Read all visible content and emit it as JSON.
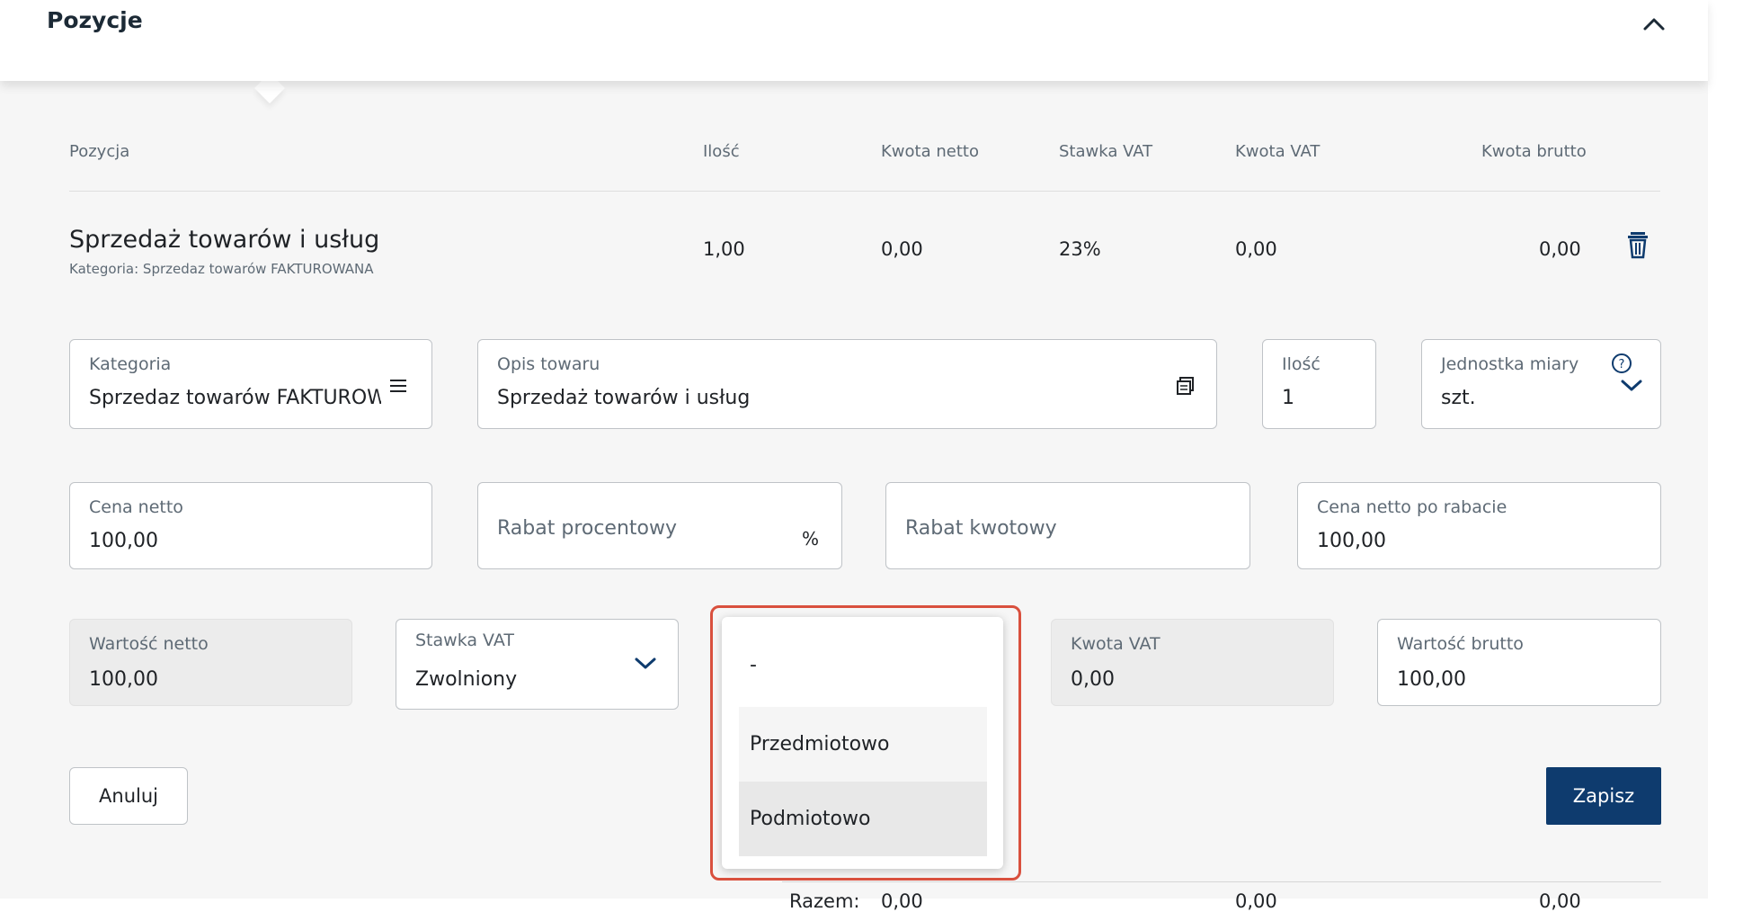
{
  "header": {
    "title": "Pozycje"
  },
  "columns": [
    "Pozycja",
    "Ilość",
    "Kwota netto",
    "Stawka VAT",
    "Kwota VAT",
    "Kwota brutto"
  ],
  "item": {
    "title": "Sprzedaż towarów i usług",
    "subtitle": "Kategoria: Sprzedaz towarów FAKTUROWANA",
    "qty": "1,00",
    "net": "0,00",
    "vat_rate": "23%",
    "vat_amount": "0,00",
    "gross": "0,00"
  },
  "form": {
    "kategoria": {
      "label": "Kategoria",
      "value": "Sprzedaz towarów FAKTUROWANA"
    },
    "opis": {
      "label": "Opis towaru",
      "value": "Sprzedaż towarów i usług"
    },
    "ilosc": {
      "label": "Ilość",
      "value": "1"
    },
    "jednostka": {
      "label": "Jednostka miary",
      "value": "szt."
    },
    "cena_netto": {
      "label": "Cena netto",
      "value": "100,00"
    },
    "rabat_proc": {
      "placeholder": "Rabat procentowy",
      "suffix": "%"
    },
    "rabat_kw": {
      "placeholder": "Rabat kwotowy"
    },
    "cena_po_rabacie": {
      "label": "Cena netto po rabacie",
      "value": "100,00"
    },
    "wartosc_netto": {
      "label": "Wartość netto",
      "value": "100,00"
    },
    "stawka_vat": {
      "label": "Stawka VAT",
      "value": "Zwolniony"
    },
    "kwota_vat": {
      "label": "Kwota VAT",
      "value": "0,00"
    },
    "wartosc_brutto": {
      "label": "Wartość brutto",
      "value": "100,00"
    }
  },
  "dropdown": {
    "options": [
      "-",
      "Przedmiotowo",
      "Podmiotowo"
    ],
    "highlighted_index": 2
  },
  "buttons": {
    "cancel": "Anuluj",
    "save": "Zapisz"
  },
  "totals": {
    "label": "Razem:",
    "net": "0,00",
    "vat": "0,00",
    "gross": "0,00"
  },
  "colors": {
    "primary": "#0e3b6e",
    "highlight_border": "#d9503e",
    "background": "#f6f6f6"
  }
}
